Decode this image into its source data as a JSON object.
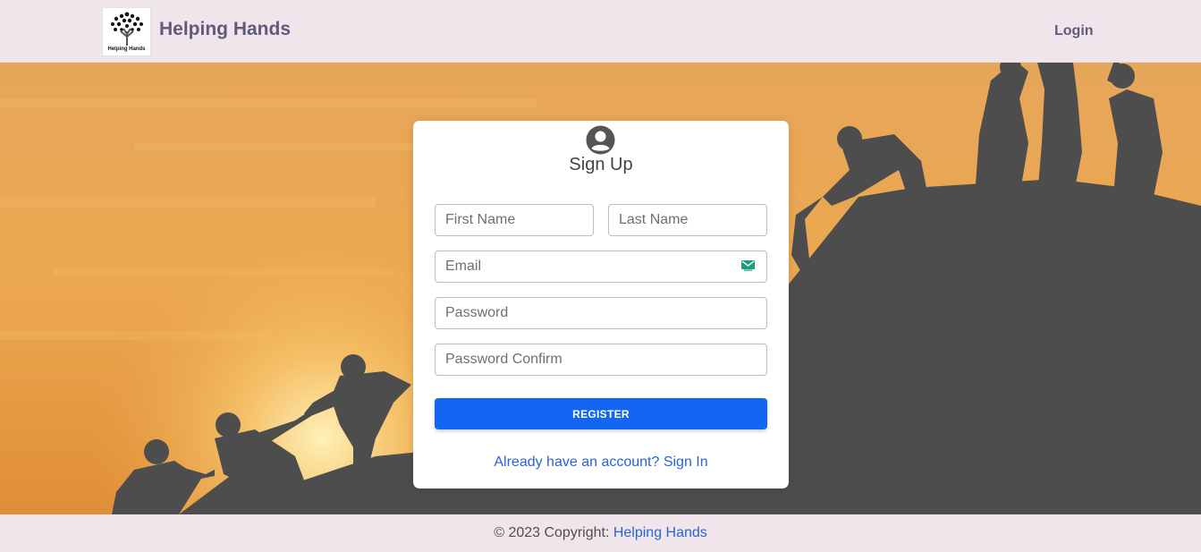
{
  "navbar": {
    "logo_text": "Helping Hands",
    "brand": "Helping Hands",
    "login_label": "Login"
  },
  "form": {
    "title": "Sign Up",
    "first_name_placeholder": "First Name",
    "last_name_placeholder": "Last Name",
    "email_placeholder": "Email",
    "password_placeholder": "Password",
    "password_confirm_placeholder": "Password Confirm",
    "register_label": "REGISTER",
    "signin_link": "Already have an account? Sign In"
  },
  "footer": {
    "copyright": "© 2023 Copyright: ",
    "link": "Helping Hands"
  },
  "colors": {
    "accent": "#1266f1",
    "link": "#2a63d4",
    "brand_text": "#5f5a7e",
    "nav_bg": "#f0e5ea"
  }
}
